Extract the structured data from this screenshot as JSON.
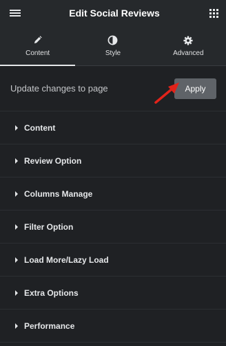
{
  "header": {
    "title": "Edit Social Reviews",
    "menu_icon": "hamburger-menu-icon",
    "apps_icon": "grid-apps-icon"
  },
  "tabs": [
    {
      "label": "Content",
      "icon": "pencil-icon",
      "active": true
    },
    {
      "label": "Style",
      "icon": "half-circle-icon",
      "active": false
    },
    {
      "label": "Advanced",
      "icon": "gear-icon",
      "active": false
    }
  ],
  "apply_bar": {
    "label": "Update changes to page",
    "button_label": "Apply"
  },
  "sections": [
    {
      "label": "Content"
    },
    {
      "label": "Review Option"
    },
    {
      "label": "Columns Manage"
    },
    {
      "label": "Filter Option"
    },
    {
      "label": "Load More/Lazy Load"
    },
    {
      "label": "Extra Options"
    },
    {
      "label": "Performance"
    }
  ],
  "colors": {
    "background": "#1f2124",
    "header": "#26292c",
    "apply_button": "#5f6368",
    "arrow": "#e2231a"
  }
}
